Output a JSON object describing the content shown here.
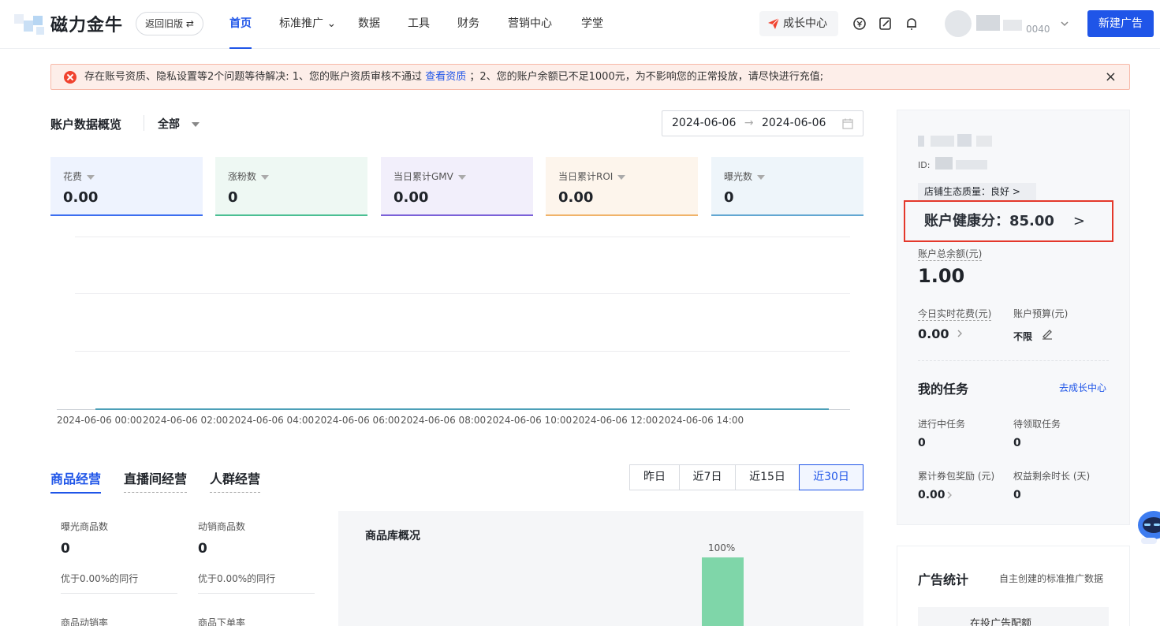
{
  "header": {
    "logo": "磁力金牛",
    "old_version": "返回旧版 ⇄",
    "nav": [
      "首页",
      "标准推广 ⌄",
      "数据",
      "工具",
      "财务",
      "营销中心",
      "学堂"
    ],
    "growth_center": "成长中心",
    "account_id_partial": "0040",
    "new_ad": "新建广告"
  },
  "alert": {
    "text1": "存在账号资质、隐私设置等2个问题等待解决: 1、您的账户资质审核不通过",
    "link": "查看资质",
    "text2": "；2、您的账户余额已不足1000元，为不影响您的正常投放，请尽快进行充值;",
    "close": "×"
  },
  "overview": {
    "title": "账户数据概览",
    "scope": "全部",
    "date_start": "2024-06-06",
    "date_sep": "→",
    "date_end": "2024-06-06",
    "kpis": [
      {
        "label": "花费",
        "value": "0.00",
        "color": "#3c6ef0",
        "bg": "#eef3fe"
      },
      {
        "label": "涨粉数",
        "value": "0",
        "color": "#4bbf93",
        "bg": "#eef8f3"
      },
      {
        "label": "当日累计GMV",
        "value": "0.00",
        "color": "#7b61d8",
        "bg": "#f2effb"
      },
      {
        "label": "当日累计ROI",
        "value": "0.00",
        "color": "#f0b36a",
        "bg": "#fdf5ec"
      },
      {
        "label": "曝光数",
        "value": "0",
        "color": "#62a7d2",
        "bg": "#eef5fa"
      }
    ]
  },
  "chart_data": {
    "type": "line",
    "x": [
      "2024-06-06 00:00",
      "2024-06-06 02:00",
      "2024-06-06 04:00",
      "2024-06-06 06:00",
      "2024-06-06 08:00",
      "2024-06-06 10:00",
      "2024-06-06 12:00",
      "2024-06-06 14:00"
    ],
    "series": [
      {
        "values": [
          0,
          0,
          0,
          0,
          0,
          0,
          0,
          0
        ]
      }
    ],
    "title": "",
    "xlabel": "",
    "ylabel": "",
    "grid": true
  },
  "biz": {
    "tabs": [
      "商品经营",
      "直播间经营",
      "人群经营"
    ],
    "ranges": [
      "昨日",
      "近7日",
      "近15日",
      "近30日"
    ],
    "metrics": [
      {
        "label": "曝光商品数",
        "value": "0",
        "cmp": "优于0.00%的同行"
      },
      {
        "label": "动销商品数",
        "value": "0",
        "cmp": "优于0.00%的同行"
      }
    ],
    "metrics2": [
      "商品动销率",
      "商品下单率"
    ],
    "lib_title": "商品库概况",
    "lib_pct": "100%",
    "lib_bar_fraction": 1.0
  },
  "account": {
    "id_label": "ID:",
    "quality": "店铺生态质量：良好 >",
    "health_label": "账户健康分：",
    "health_value": "85.00",
    "health_arrow": ">",
    "balance_label": "账户总余额(元)",
    "balance": "1.00",
    "today_spend_label": "今日实时花费(元)",
    "today_spend": "0.00",
    "budget_label": "账户预算(元)",
    "budget": "不限"
  },
  "tasks": {
    "title": "我的任务",
    "link": "去成长中心",
    "items": [
      {
        "label": "进行中任务",
        "value": "0"
      },
      {
        "label": "待领取任务",
        "value": "0"
      },
      {
        "label": "累计券包奖励 (元)",
        "value": "0.00"
      },
      {
        "label": "权益剩余时长 (天)",
        "value": "0"
      }
    ]
  },
  "ads": {
    "title": "广告统计",
    "subtitle": "自主创建的标准推广数据",
    "box": "在投广告配额"
  }
}
